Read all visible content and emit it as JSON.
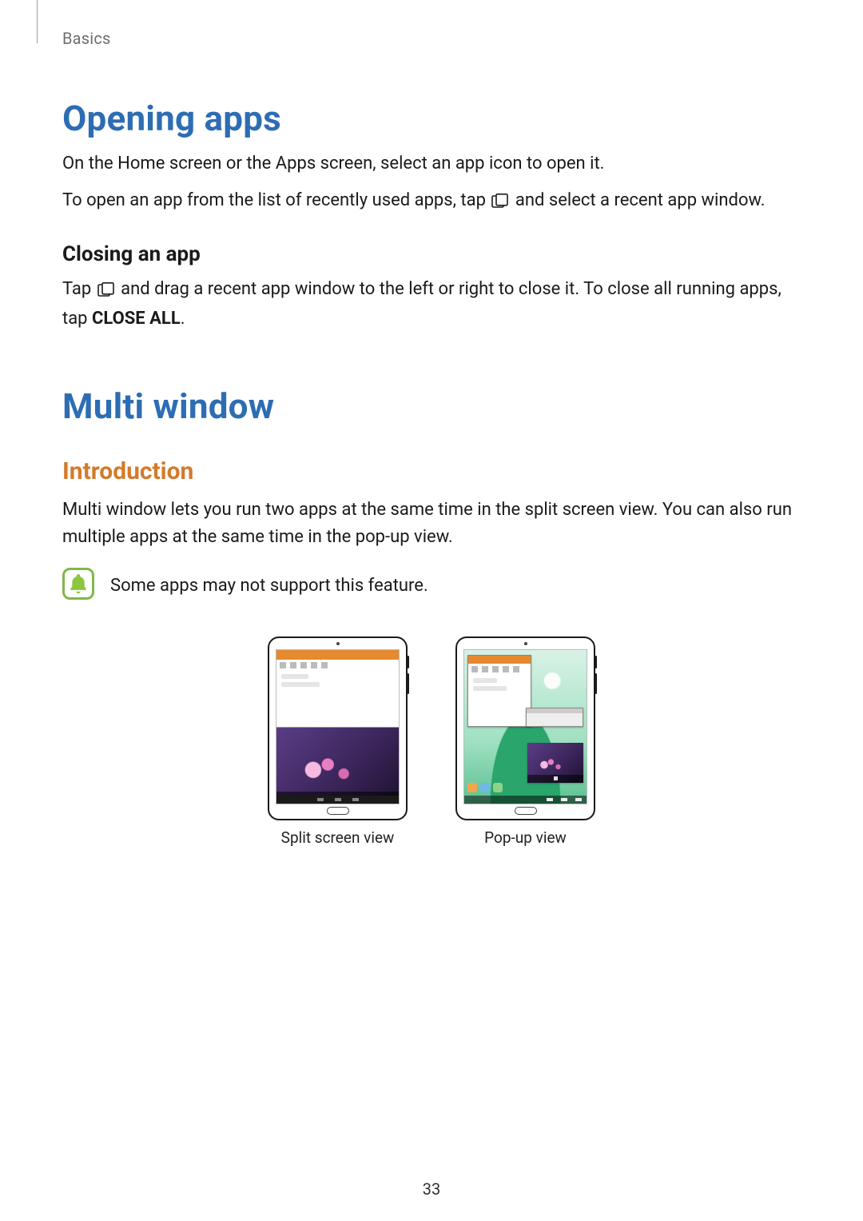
{
  "breadcrumb": "Basics",
  "h1_opening": "Opening apps",
  "p_open1": "On the Home screen or the Apps screen, select an app icon to open it.",
  "p_open2a": "To open an app from the list of recently used apps, tap ",
  "p_open2b": " and select a recent app window.",
  "h3_closing": "Closing an app",
  "p_close_a": "Tap ",
  "p_close_b": " and drag a recent app window to the left or right to close it. To close all running apps, tap ",
  "p_close_bold": "CLOSE ALL",
  "p_close_c": ".",
  "h1_multi": "Multi window",
  "h2_intro": "Introduction",
  "p_intro": "Multi window lets you run two apps at the same time in the split screen view. You can also run multiple apps at the same time in the pop-up view.",
  "note_text": "Some apps may not support this feature.",
  "caption_split": "Split screen view",
  "caption_popup": "Pop-up view",
  "page_number": "33"
}
